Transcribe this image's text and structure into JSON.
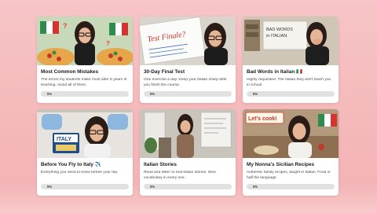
{
  "courses": [
    {
      "title": "Most Common Mistakes",
      "description": "The errors my students make most after 6 years of teaching. Avoid all of them.",
      "progress_label": "0%",
      "progress": 0,
      "thumbnail": "woman-glasses-with-pizzas-and-italian-flags",
      "accent": "#d9534f"
    },
    {
      "title": "30-Day Final Test",
      "description": "One exercise a day. Keep your Italian sharp after you finish the course.",
      "progress_label": "0%",
      "progress": 0,
      "thumbnail": "whiteboard-test-finale",
      "board_text": "Test Finale?",
      "accent": "#d9534f"
    },
    {
      "title": "Bad Words in Italian 🇮🇹",
      "description": "Highly requested. The Italian they don't teach you in school.",
      "progress_label": "0%",
      "progress": 0,
      "thumbnail": "woman-covering-mouth-bad-words-board",
      "board_text": "BAD WORDS in ITALIAN",
      "accent": "#2c6e49"
    },
    {
      "title": "Before You Fly to Italy ✈️",
      "description": "Everything you need to know before your trip.",
      "progress_label": "0%",
      "progress": 0,
      "thumbnail": "woman-in-plane-with-passport",
      "sign_text": "ITALY",
      "accent": "#1f4e8c"
    },
    {
      "title": "Italian Stories",
      "description": "Read and listen to real Italian stories. New vocabulary in every one.",
      "progress_label": "0%",
      "progress": 0,
      "thumbnail": "woman-standing-at-whiteboard",
      "accent": "#8a7a6a"
    },
    {
      "title": "My Nonna's Sicilian Recipes",
      "description": "Authentic family recipes, taught in Italian. Food is half the language.",
      "progress_label": "0%",
      "progress": 0,
      "thumbnail": "woman-in-kitchen-lets-cook",
      "sign_text": "Let's cook!",
      "accent": "#d9534f"
    }
  ]
}
